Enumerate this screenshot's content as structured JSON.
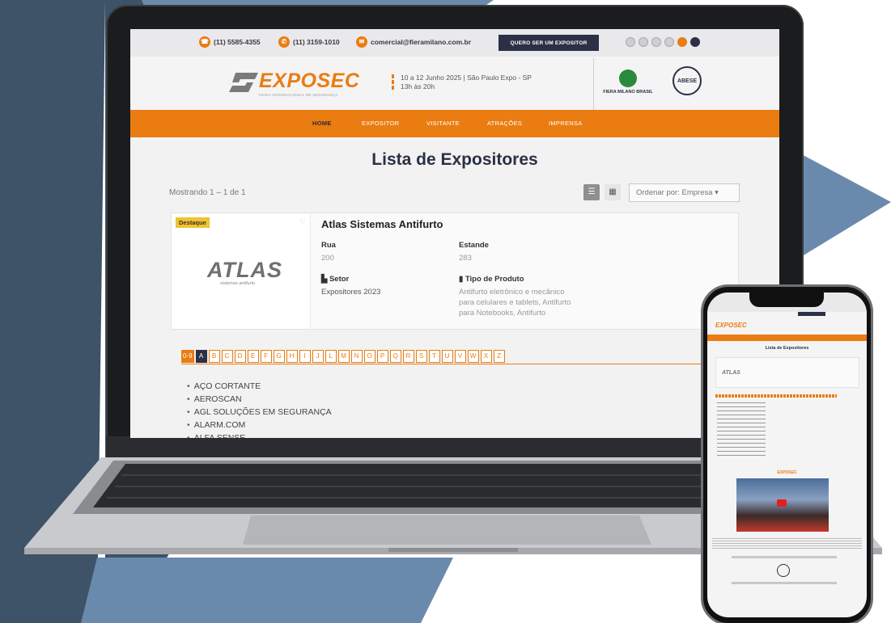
{
  "topbar": {
    "phone1": "(11) 5585-4355",
    "phone2": "(11) 3159-1010",
    "email": "comercial@fieramilano.com.br",
    "cta": "QUERO SER UM EXPOSITOR"
  },
  "header": {
    "logo": "EXPOSEC",
    "logo_sub": "FEIRA INTERNACIONAL DE SEGURANÇA",
    "event_line1": "10 a 12 Junho 2025 | São Paulo Expo - SP",
    "event_line2": "13h às 20h",
    "partner1": "FIERA MILANO BRASIL",
    "partner2": "ABESE"
  },
  "nav": {
    "items": [
      "HOME",
      "EXPOSITOR",
      "VISITANTE",
      "ATRAÇÕES",
      "IMPRENSA"
    ]
  },
  "page": {
    "title": "Lista de Expositores",
    "showing": "Mostrando 1 – 1 de 1",
    "sort": "Ordenar por: Empresa"
  },
  "card": {
    "badge": "Destaque",
    "logo": "ATLAS",
    "logo_sub": "sistemas antifurto",
    "title": "Atlas Sistemas Antifurto",
    "rua_label": "Rua",
    "rua_value": "200",
    "estande_label": "Estande",
    "estande_value": "283",
    "setor_label": "Setor",
    "setor_value": "Expositores 2023",
    "tipo_label": "Tipo de Produto",
    "tipo_line1": "Antifurto eletrônico e mecânico",
    "tipo_line2": "para celulares e tablets, Antifurto",
    "tipo_line3": "para Notebooks, Antifurto"
  },
  "alphabet": [
    "0-9",
    "A",
    "B",
    "C",
    "D",
    "E",
    "F",
    "G",
    "H",
    "I",
    "J",
    "L",
    "M",
    "N",
    "O",
    "P",
    "Q",
    "R",
    "S",
    "T",
    "U",
    "V",
    "W",
    "X",
    "Z"
  ],
  "exhibitors": [
    "AÇO CORTANTE",
    "AEROSCAN",
    "AGL SOLUÇÕES EM SEGURANÇA",
    "ALARM.COM",
    "ALFA SENSE"
  ],
  "phone": {
    "title": "Lista de Expositores",
    "section": "EXPOSEC"
  },
  "colors": {
    "accent": "#ea7c12",
    "navy": "#2b3046",
    "bg_dark": "#3e5268",
    "bg_light": "#6a8aad"
  }
}
